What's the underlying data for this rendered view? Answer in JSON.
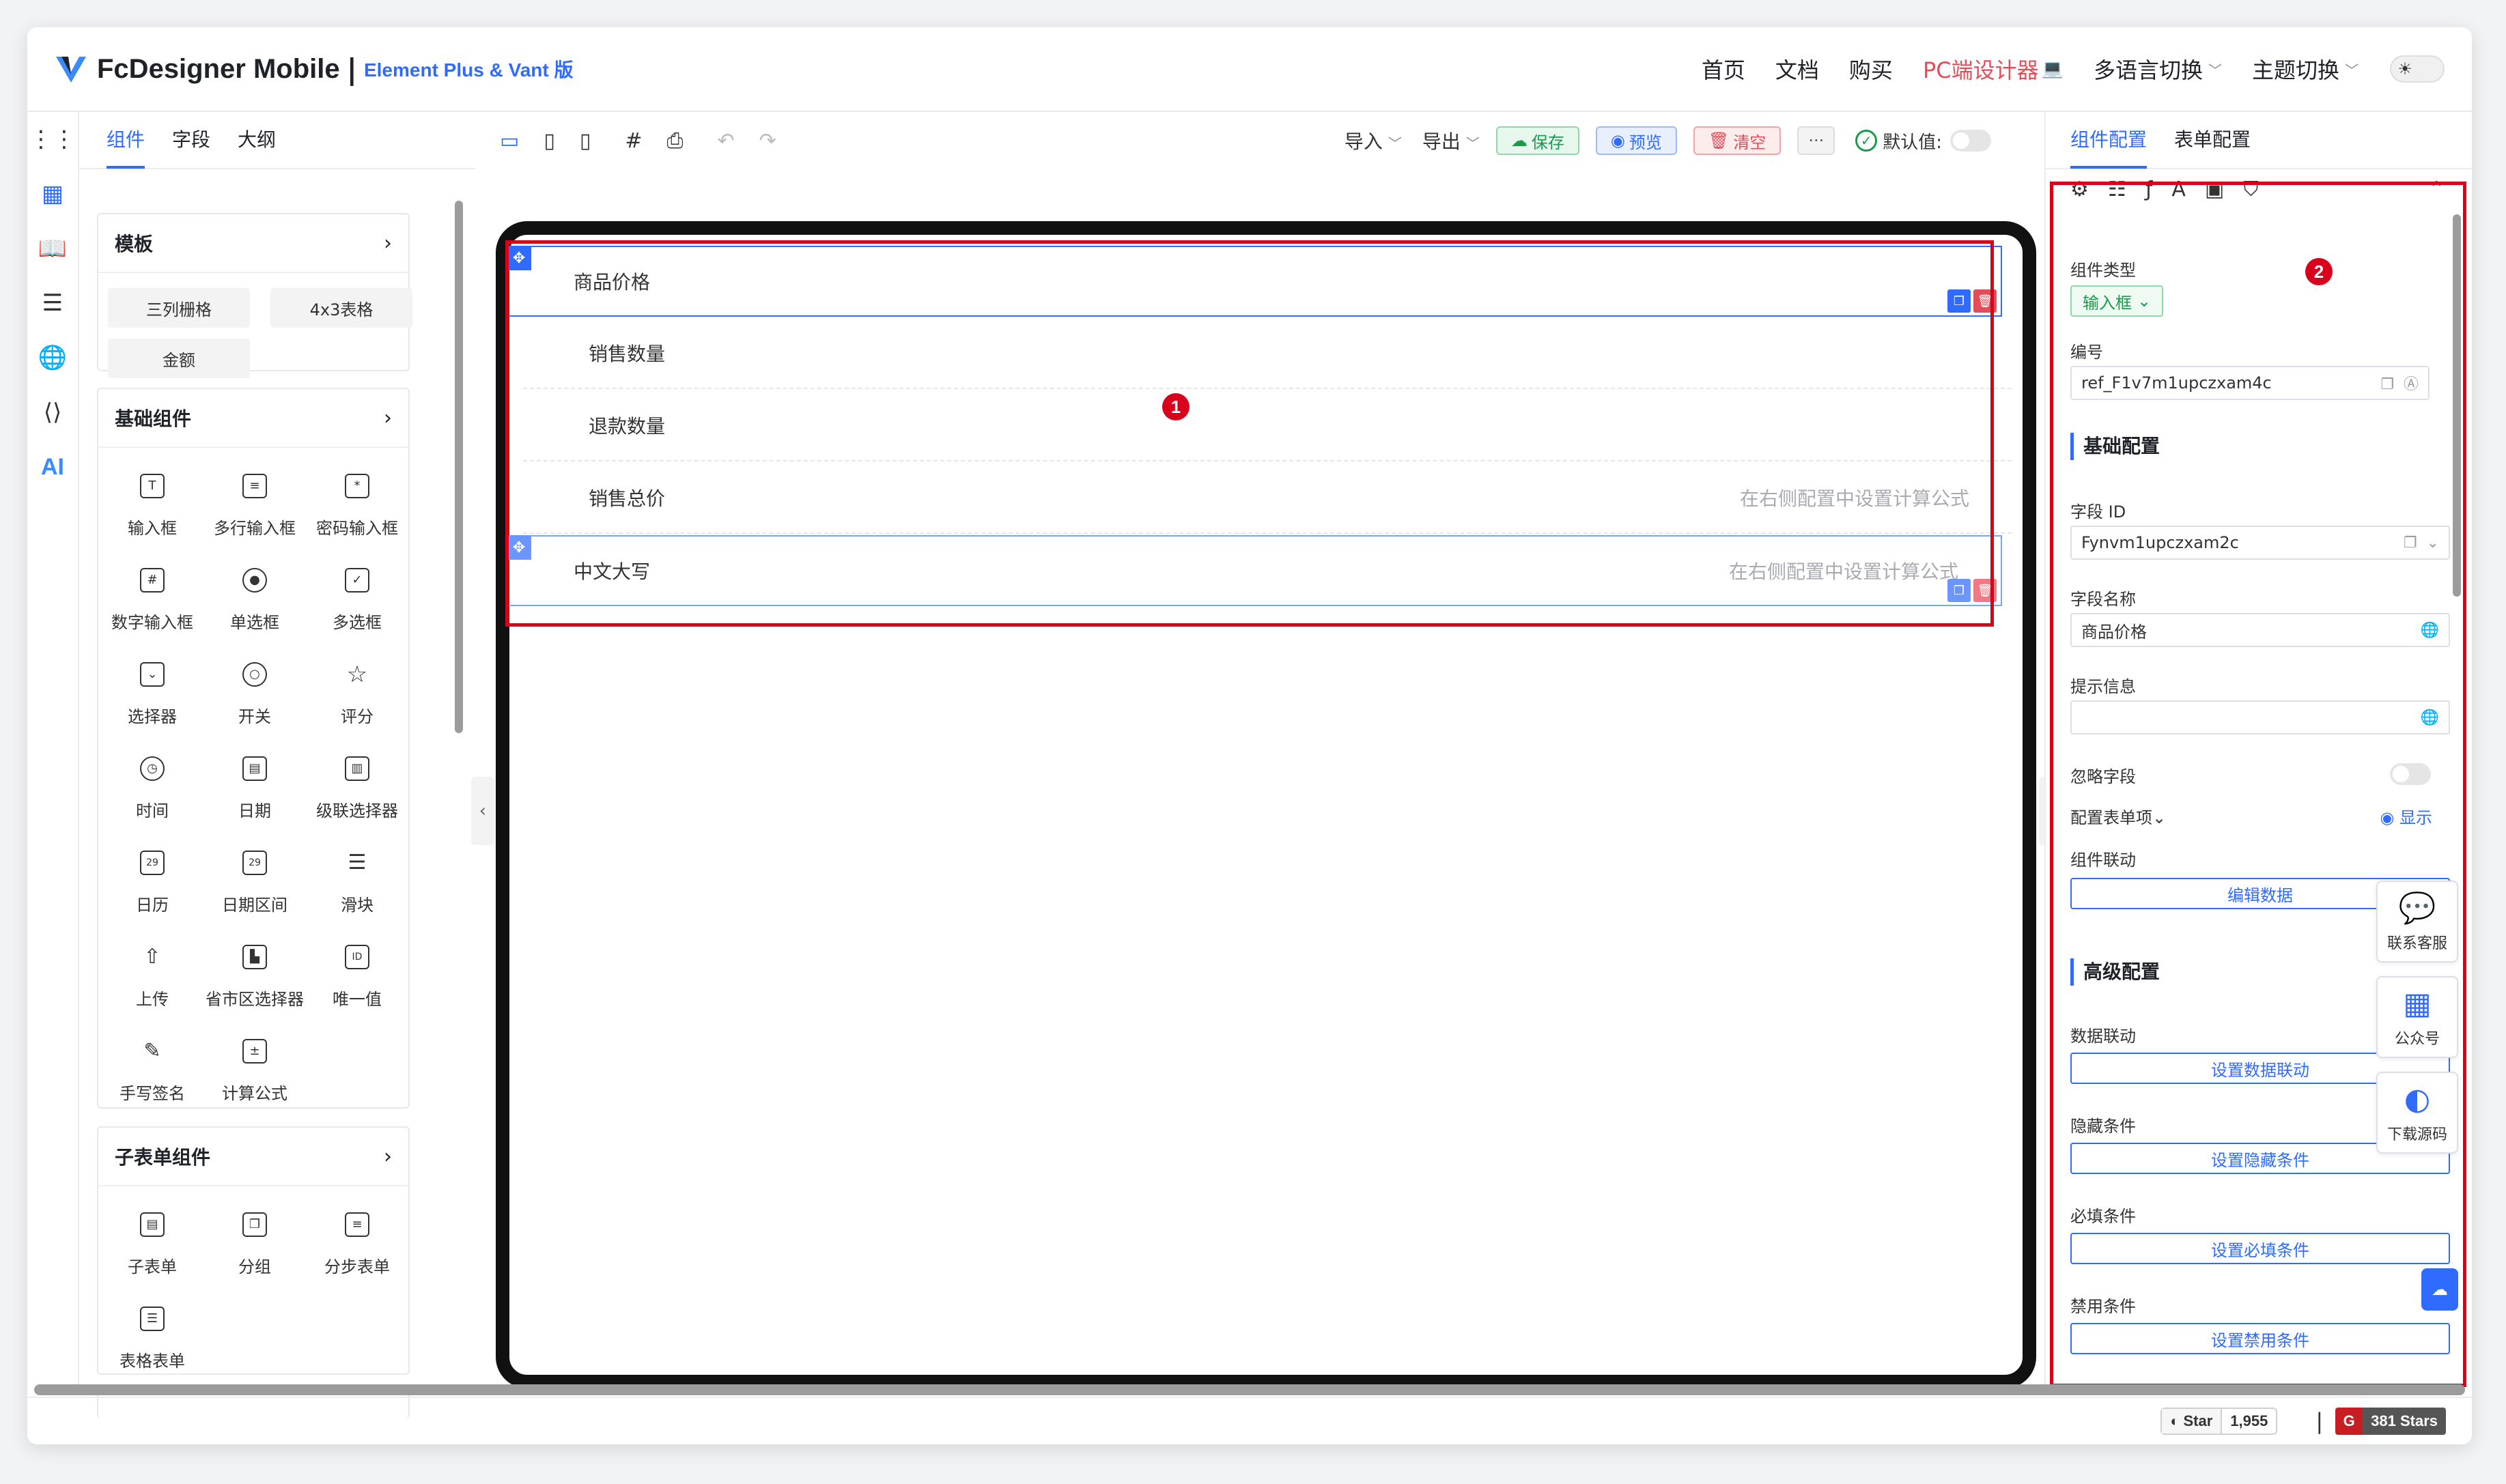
{
  "header": {
    "brand": "FcDesigner Mobile",
    "brand_sep": "|",
    "brand_sub": "Element Plus & Vant 版",
    "nav": {
      "home": "首页",
      "docs": "文档",
      "buy": "购买",
      "pc": "PC端设计器",
      "lang": "多语言切换",
      "theme": "主题切换"
    }
  },
  "palette": {
    "tabs": {
      "components": "组件",
      "fields": "字段",
      "outline": "大纲"
    },
    "templates": {
      "title": "模板",
      "items": [
        "三列栅格",
        "4x3表格",
        "金额"
      ]
    },
    "basic": {
      "title": "基础组件",
      "items": [
        "输入框",
        "多行输入框",
        "密码输入框",
        "数字输入框",
        "单选框",
        "多选框",
        "选择器",
        "开关",
        "评分",
        "时间",
        "日期",
        "级联选择器",
        "日历",
        "日期区间",
        "滑块",
        "上传",
        "省市区选择器",
        "唯一值",
        "手写签名",
        "计算公式"
      ]
    },
    "subform": {
      "title": "子表单组件",
      "items": [
        "子表单",
        "分组",
        "分步表单",
        "表格表单"
      ]
    }
  },
  "toolbar": {
    "import": "导入",
    "export": "导出",
    "save": "保存",
    "preview": "预览",
    "clear": "清空",
    "more": "···",
    "default_value": "默认值:"
  },
  "canvas": {
    "rows": [
      {
        "label": "商品价格",
        "placeholder": ""
      },
      {
        "label": "销售数量",
        "placeholder": ""
      },
      {
        "label": "退款数量",
        "placeholder": ""
      },
      {
        "label": "销售总价",
        "placeholder": "在右侧配置中设置计算公式"
      },
      {
        "label": "中文大写",
        "placeholder": "在右侧配置中设置计算公式"
      }
    ],
    "badge1": "1",
    "badge2": "2"
  },
  "config": {
    "tabs": {
      "component": "组件配置",
      "form": "表单配置"
    },
    "component_type_label": "组件类型",
    "component_type_value": "输入框",
    "id_label": "编号",
    "id_value": "ref_F1v7m1upczxam4c",
    "basic_section": "基础配置",
    "field_id_label": "字段 ID",
    "field_id_value": "Fynvm1upczxam2c",
    "field_name_label": "字段名称",
    "field_name_value": "商品价格",
    "hint_label": "提示信息",
    "hint_value": "",
    "ignore_label": "忽略字段",
    "config_items_label": "配置表单项",
    "show_label": "显示",
    "linkage_label": "组件联动",
    "edit_data_button": "编辑数据",
    "advanced_section": "高级配置",
    "data_linkage_label": "数据联动",
    "data_linkage_button": "设置数据联动",
    "hide_label": "隐藏条件",
    "hide_button": "设置隐藏条件",
    "required_label": "必填条件",
    "required_button": "设置必填条件",
    "disable_label": "禁用条件",
    "disable_button": "设置禁用条件"
  },
  "floating": {
    "support": "联系客服",
    "wechat": "公众号",
    "download": "下载源码",
    "ai": "AI"
  },
  "footer": {
    "star_label": "Star",
    "star_count": "1,955",
    "pipe": "|",
    "gitee_stars": "381 Stars"
  },
  "colors": {
    "accent": "#2f6bff",
    "danger": "#e34d59",
    "success": "#1a9a4a",
    "annotation": "#d9001b"
  }
}
